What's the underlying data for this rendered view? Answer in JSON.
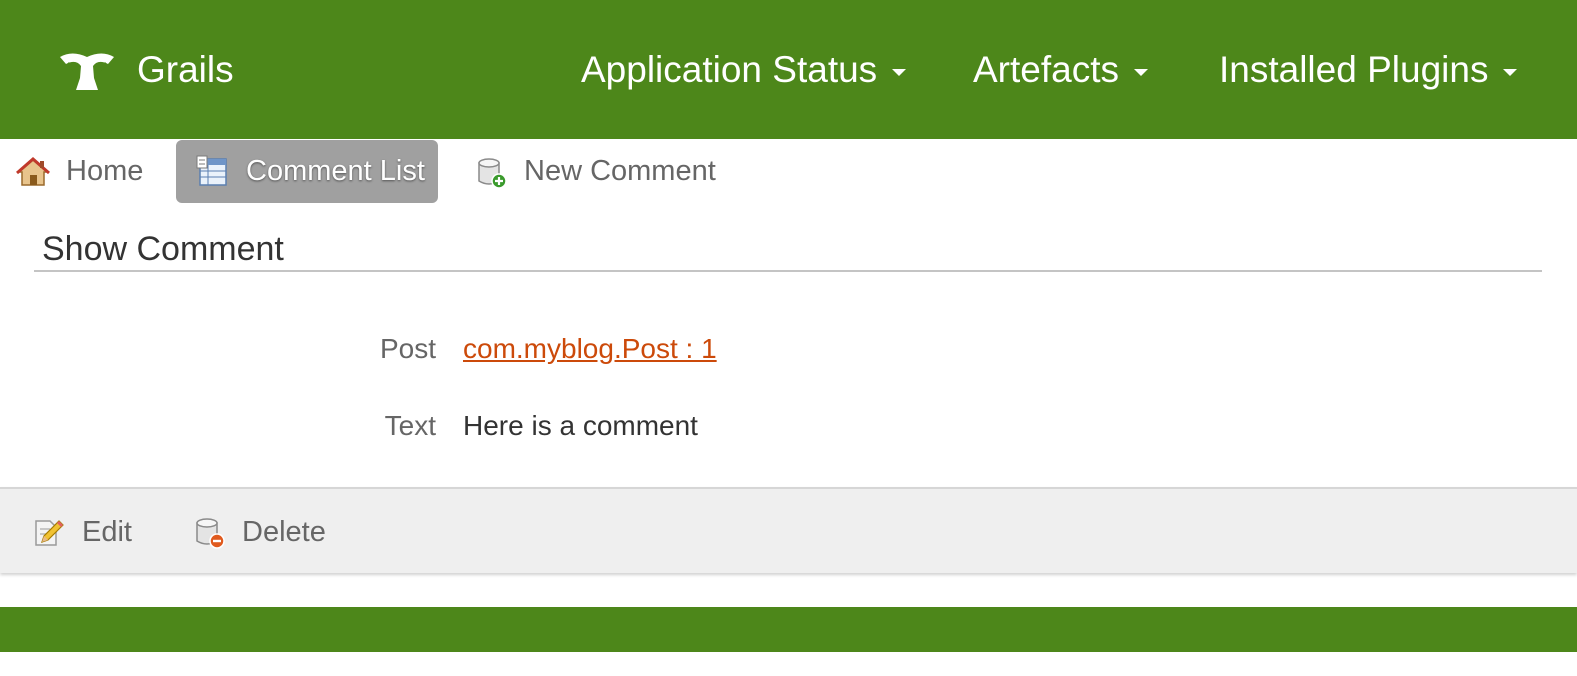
{
  "brand": {
    "name": "Grails",
    "icon": "grails-cup-icon"
  },
  "topnav": [
    {
      "label": "Application Status"
    },
    {
      "label": "Artefacts"
    },
    {
      "label": "Installed Plugins"
    }
  ],
  "subnav": {
    "home": {
      "label": "Home",
      "icon": "home-icon"
    },
    "list": {
      "label": "Comment List",
      "icon": "list-icon",
      "active": true
    },
    "new": {
      "label": "New Comment",
      "icon": "database-add-icon"
    }
  },
  "page": {
    "title": "Show Comment"
  },
  "properties": [
    {
      "label": "Post",
      "value": "com.myblog.Post : 1",
      "is_link": true
    },
    {
      "label": "Text",
      "value": "Here is a comment",
      "is_link": false
    }
  ],
  "buttons": {
    "edit": {
      "label": "Edit",
      "icon": "pencil-edit-icon"
    },
    "delete": {
      "label": "Delete",
      "icon": "database-delete-icon"
    }
  },
  "colors": {
    "header_green": "#4d871a",
    "link_orange": "#cc4a0a",
    "active_tab": "#a0a0a0",
    "button_bar": "#efefef"
  }
}
